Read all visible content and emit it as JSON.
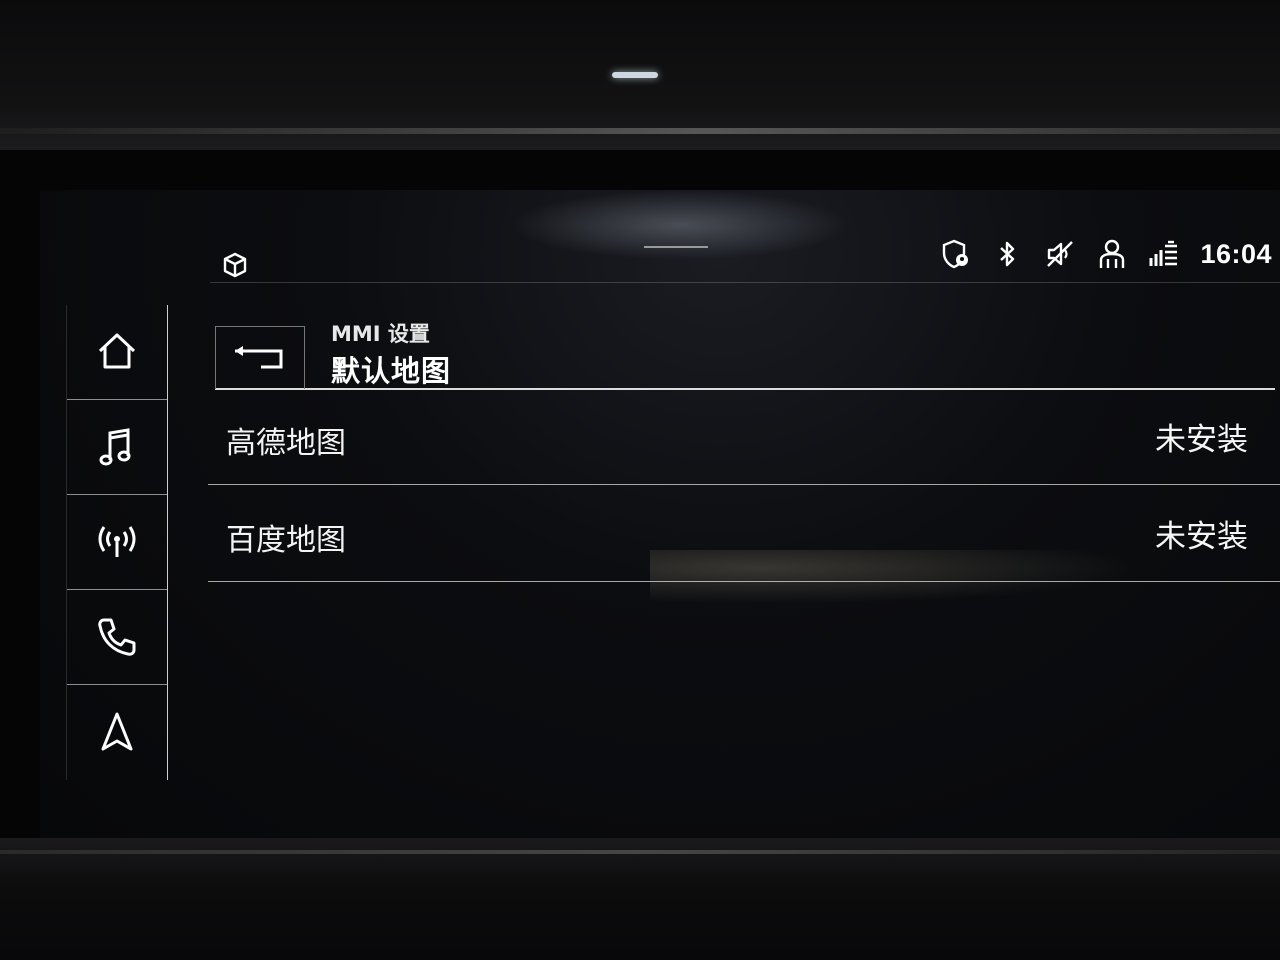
{
  "status_bar": {
    "time": "16:04",
    "icons": [
      "location-alert-icon",
      "bluetooth-icon",
      "muted-speaker-icon",
      "user-profile-icon",
      "connectivity-icon"
    ]
  },
  "nav": {
    "items": [
      {
        "name": "home",
        "icon": "home-icon"
      },
      {
        "name": "media",
        "icon": "music-note-icon"
      },
      {
        "name": "radio",
        "icon": "radio-antenna-icon"
      },
      {
        "name": "phone",
        "icon": "phone-icon"
      },
      {
        "name": "navigation",
        "icon": "navigation-arrow-icon"
      }
    ]
  },
  "header": {
    "breadcrumb": "MMI 设置",
    "title": "默认地图"
  },
  "list": {
    "items": [
      {
        "label": "高德地图",
        "value": "未安装"
      },
      {
        "label": "百度地图",
        "value": "未安装"
      }
    ]
  }
}
